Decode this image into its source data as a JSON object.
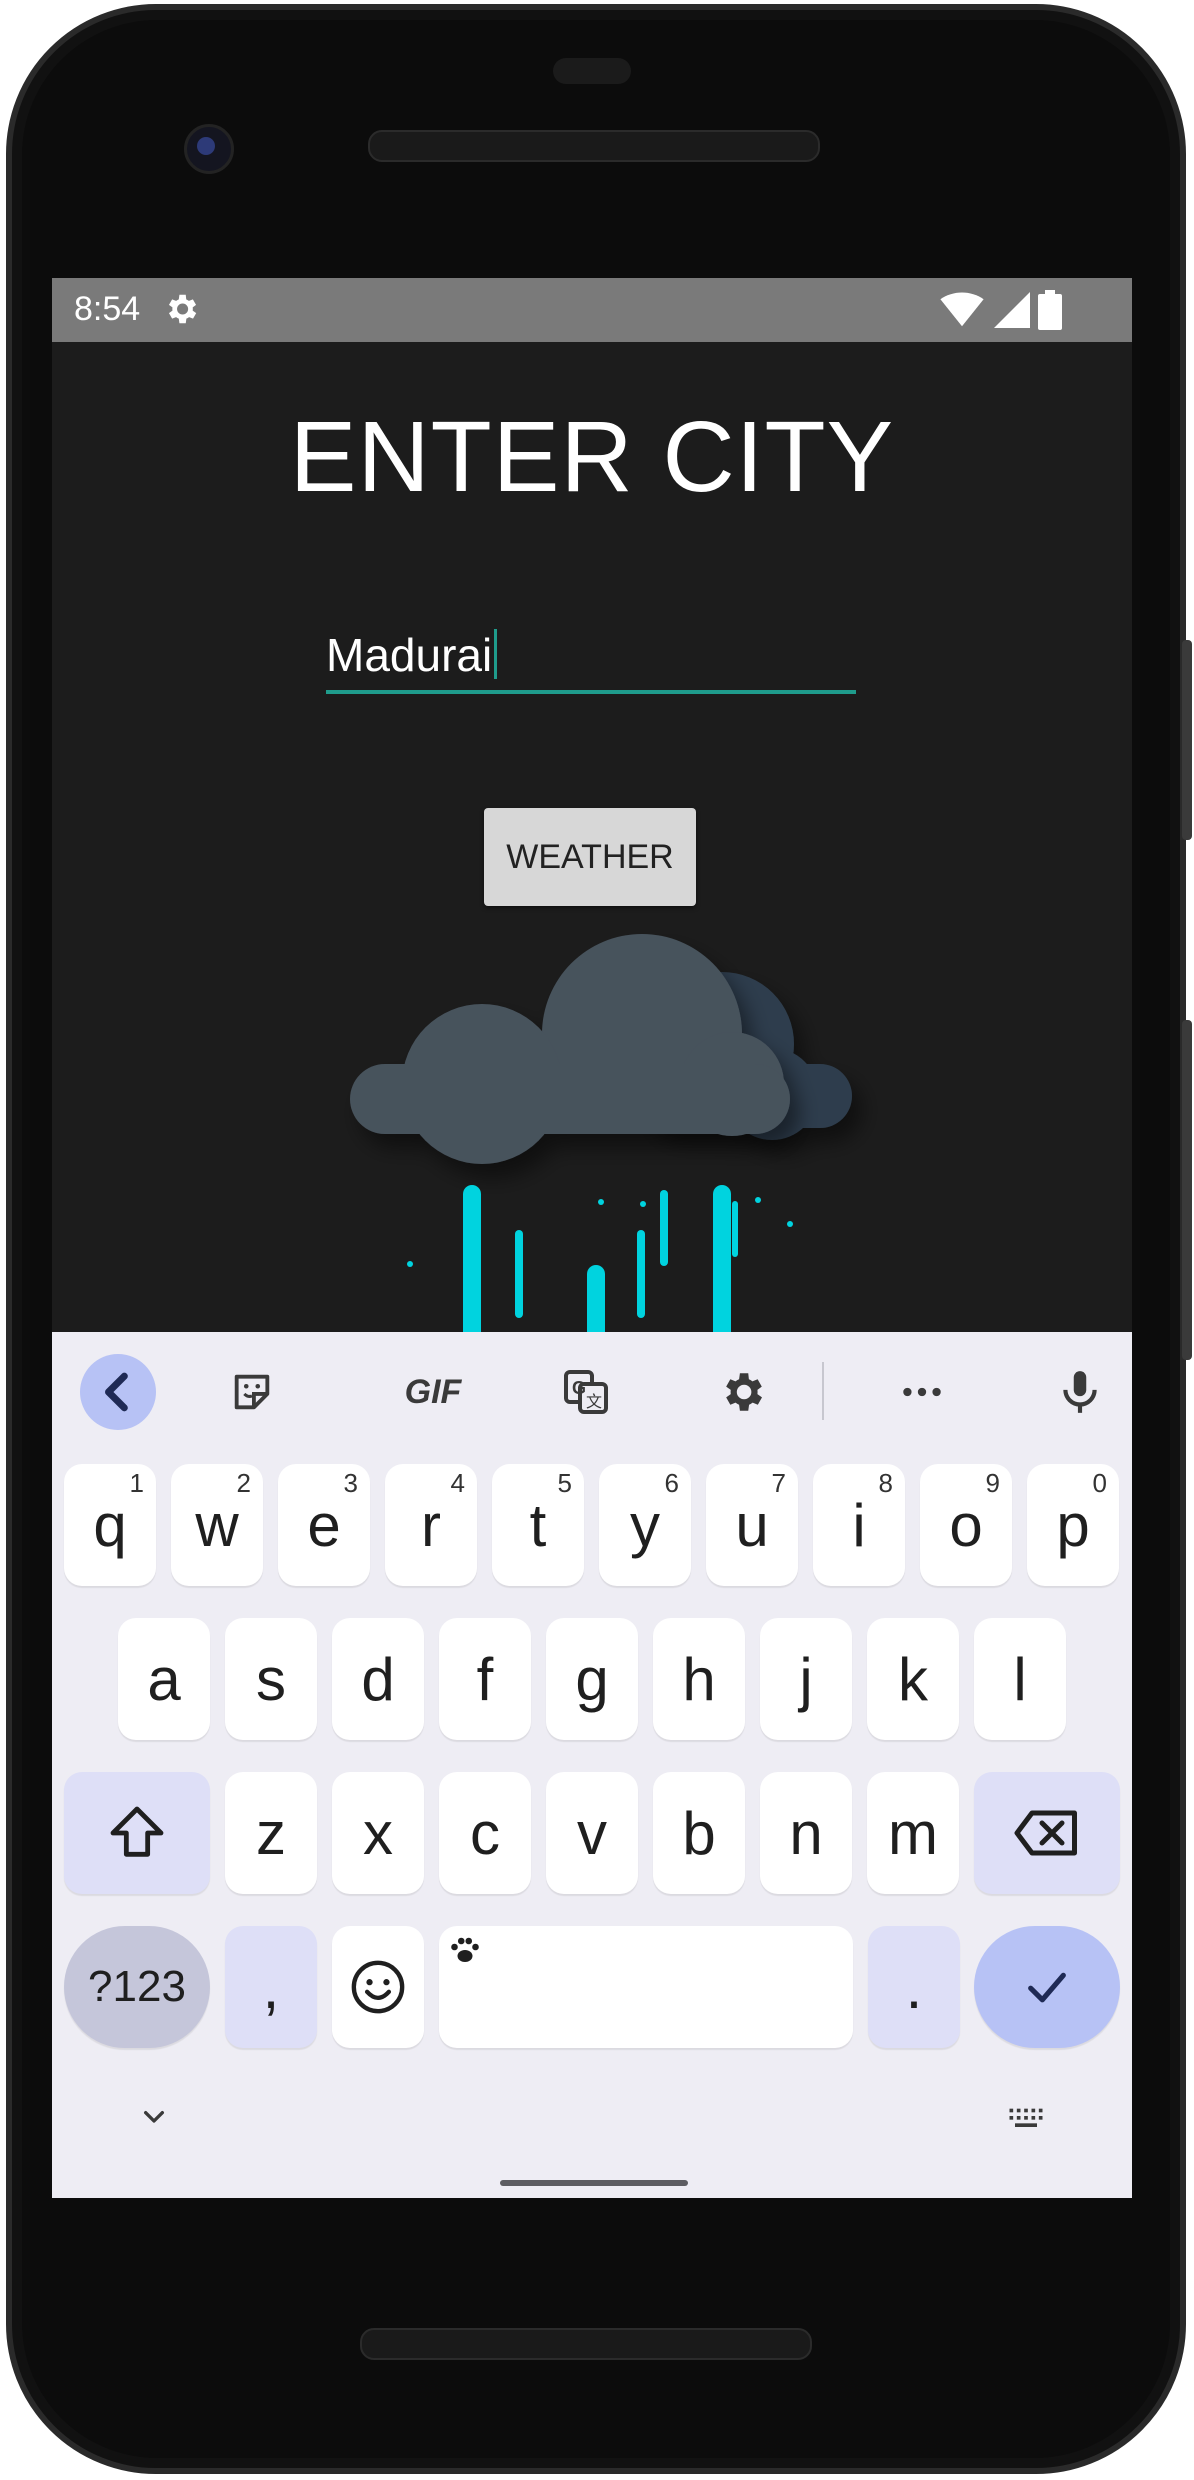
{
  "status_bar": {
    "time": "8:54",
    "icons": [
      "gear-icon",
      "wifi-icon",
      "signal-icon",
      "battery-icon"
    ]
  },
  "app": {
    "title": "ENTER CITY",
    "city_input_value": "Madurai",
    "weather_button_label": "WEATHER",
    "illustration": "rain-cloud-icon"
  },
  "keyboard": {
    "toolbar_icons": [
      "chevron-left-icon",
      "sticker-icon",
      "gif-icon",
      "translate-icon",
      "gear-icon",
      "more-icon",
      "mic-icon"
    ],
    "gif_label": "GIF",
    "row1": [
      {
        "key": "q",
        "hint": "1"
      },
      {
        "key": "w",
        "hint": "2"
      },
      {
        "key": "e",
        "hint": "3"
      },
      {
        "key": "r",
        "hint": "4"
      },
      {
        "key": "t",
        "hint": "5"
      },
      {
        "key": "y",
        "hint": "6"
      },
      {
        "key": "u",
        "hint": "7"
      },
      {
        "key": "i",
        "hint": "8"
      },
      {
        "key": "o",
        "hint": "9"
      },
      {
        "key": "p",
        "hint": "0"
      }
    ],
    "row2": [
      "a",
      "s",
      "d",
      "f",
      "g",
      "h",
      "j",
      "k",
      "l"
    ],
    "row3": [
      "z",
      "x",
      "c",
      "v",
      "b",
      "n",
      "m"
    ],
    "symbols_label": "?123",
    "comma_label": ",",
    "period_label": ".",
    "bottom_icons": [
      "chevron-down-icon",
      "keyboard-icon"
    ]
  },
  "colors": {
    "screen_background": "#1c1c1c",
    "accent": "#1f9c8c",
    "keyboard_background": "#eeedf4",
    "enter_key": "#b7c2f5",
    "function_key": "#dedff7"
  }
}
